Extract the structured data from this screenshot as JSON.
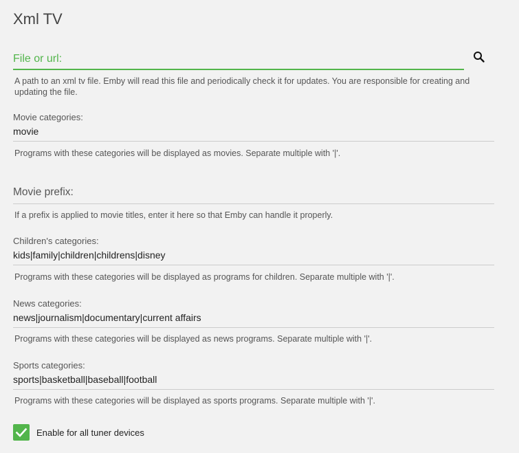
{
  "page": {
    "title": "Xml TV"
  },
  "file_url": {
    "label": "File or url:",
    "help": "A path to an xml tv file. Emby will read this file and periodically check it for updates. You are responsible for creating and updating the file."
  },
  "movie_categories": {
    "label": "Movie categories:",
    "value": "movie",
    "help": "Programs with these categories will be displayed as movies. Separate multiple with '|'."
  },
  "movie_prefix": {
    "label": "Movie prefix:",
    "help": "If a prefix is applied to movie titles, enter it here so that Emby can handle it properly."
  },
  "children_categories": {
    "label": "Children's categories:",
    "value": "kids|family|children|childrens|disney",
    "help": "Programs with these categories will be displayed as programs for children. Separate multiple with '|'."
  },
  "news_categories": {
    "label": "News categories:",
    "value": "news|journalism|documentary|current affairs",
    "help": "Programs with these categories will be displayed as news programs. Separate multiple with '|'."
  },
  "sports_categories": {
    "label": "Sports categories:",
    "value": "sports|basketball|baseball|football",
    "help": "Programs with these categories will be displayed as sports programs. Separate multiple with '|'."
  },
  "enable_all_tuners": {
    "label": "Enable for all tuner devices",
    "checked": true
  },
  "icons": {
    "search": "search-icon",
    "check": "check-icon"
  },
  "colors": {
    "accent": "#52b54b",
    "background": "#f2f2f2"
  }
}
